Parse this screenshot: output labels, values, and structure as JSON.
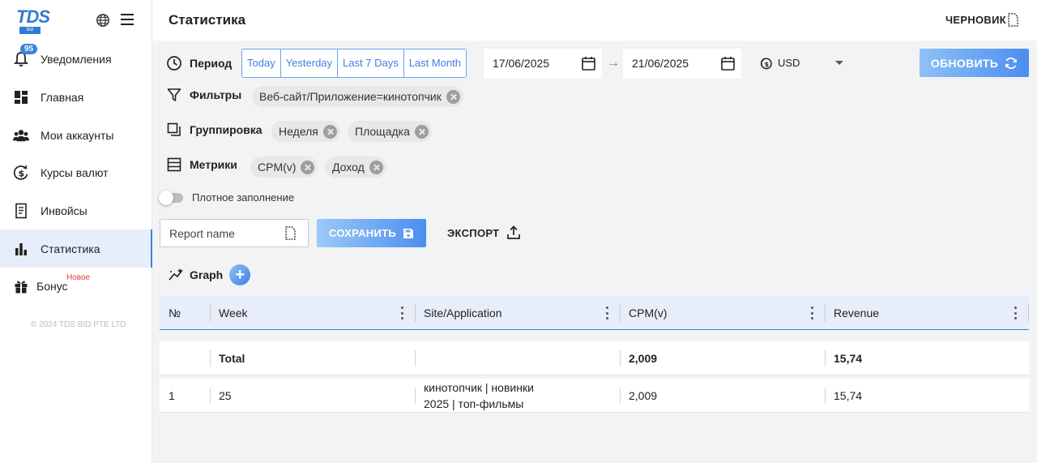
{
  "sidebar": {
    "logo_text": "TDS",
    "logo_sub": "bid",
    "items": [
      {
        "label": "Уведомления",
        "badge": "95",
        "icon": "bell-icon"
      },
      {
        "label": "Главная",
        "icon": "dashboard-icon"
      },
      {
        "label": "Мои аккаунты",
        "icon": "users-icon"
      },
      {
        "label": "Курсы валют",
        "icon": "currency-exchange-icon"
      },
      {
        "label": "Инвойсы",
        "icon": "receipt-icon"
      },
      {
        "label": "Статистика",
        "icon": "bar-chart-icon",
        "active": true
      },
      {
        "label": "Бонус",
        "tag": "Новое",
        "icon": "gift-icon"
      }
    ],
    "copyright": "© 2024 TDS BID PTE LTD"
  },
  "header": {
    "title": "Статистика",
    "draft_label": "ЧЕРНОВИК"
  },
  "filters": {
    "period_label": "Период",
    "period_buttons": [
      "Today",
      "Yesterday",
      "Last 7 Days",
      "Last Month"
    ],
    "date_from": "17/06/2025",
    "date_to": "21/06/2025",
    "currency": "USD",
    "refresh_label": "ОБНОВИТЬ",
    "filters_label": "Фильтры",
    "filter_chips": [
      "Веб-сайт/Приложение=кинотопчик"
    ],
    "grouping_label": "Группировка",
    "grouping_chips": [
      "Неделя",
      "Площадка"
    ],
    "metrics_label": "Метрики",
    "metrics_chips": [
      "CPM(v)",
      "Доход"
    ],
    "dense_label": "Плотное заполнение"
  },
  "actions": {
    "report_placeholder": "Report name",
    "save_label": "СОХРАНИТЬ",
    "export_label": "ЭКСПОРТ",
    "graph_label": "Graph"
  },
  "table": {
    "columns": [
      "№",
      "Week",
      "Site/Application",
      "CPM(v)",
      "Revenue"
    ],
    "total": {
      "label": "Total",
      "cpm": "2,009",
      "revenue": "15,74"
    },
    "rows": [
      {
        "num": "1",
        "week": "25",
        "site": "кинотопчик | новинки 2025 | топ-фильмы",
        "cpm": "2,009",
        "revenue": "15,74"
      }
    ]
  },
  "colors": {
    "accent": "#3f7fe0",
    "badge_new": "#e53935"
  }
}
